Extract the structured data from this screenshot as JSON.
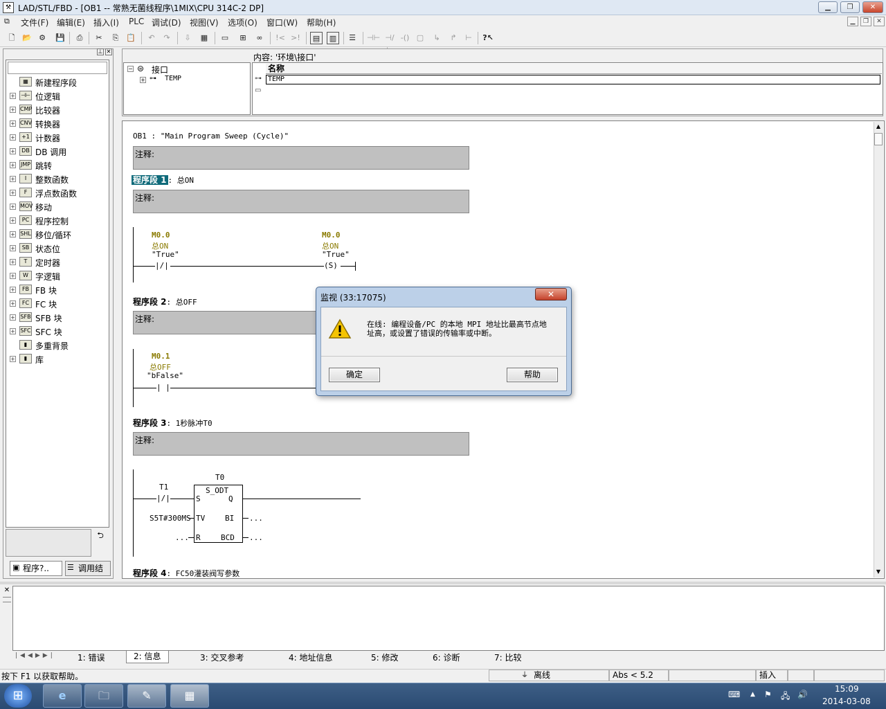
{
  "window": {
    "title": "LAD/STL/FBD  - [OB1 -- 常熟无菌线程序\\1MIX\\CPU 314C-2 DP]"
  },
  "menu": [
    "文件(F)",
    "编辑(E)",
    "插入(I)",
    "PLC",
    "调试(D)",
    "视图(V)",
    "选项(O)",
    "窗口(W)",
    "帮助(H)"
  ],
  "toolbar": {
    "icons": [
      "new-icon",
      "open-icon",
      "accessible-nodes-icon",
      "save-icon",
      "print-icon",
      "cut-icon",
      "copy-icon",
      "paste-icon",
      "undo-icon",
      "redo-icon",
      "load-icon",
      "compile-icon",
      "monitor-icon",
      "network-icon",
      "glasses-icon",
      "branch-icon",
      "overview-icon",
      "view-icon",
      "contact-no-icon",
      "contact-nc-icon",
      "coil-icon",
      "box-icon",
      "branch-open-icon",
      "branch-close-icon",
      "help-icon"
    ]
  },
  "catalog": {
    "items": [
      "新建程序段",
      "位逻辑",
      "比较器",
      "转换器",
      "计数器",
      "DB 调用",
      "跳转",
      "整数函数",
      "浮点数函数",
      "移动",
      "程序控制",
      "移位/循环",
      "状态位",
      "定时器",
      "字逻辑",
      "FB 块",
      "FC 块",
      "SFB 块",
      "SFC 块",
      "多重背景",
      "库"
    ],
    "tabs": [
      "程序?..",
      "调用结构"
    ]
  },
  "interface": {
    "content_label": "内容:  '环境\\接口'",
    "tree_root": "接口",
    "tree_child": "TEMP",
    "col_header": "名称",
    "row1": "TEMP"
  },
  "editor": {
    "ob_title": "OB1 :  \"Main Program Sweep (Cycle)\"",
    "comment_label": "注释:",
    "net1": {
      "label": "程序段 1",
      "title": ": 总ON",
      "c_addr": "M0.0",
      "c_sym": "总ON",
      "c_true": "\"True\"",
      "coil_addr": "M0.0",
      "coil_sym": "总ON",
      "coil_true": "\"True\"",
      "coil_text": "(S)"
    },
    "net2": {
      "label": "程序段 2",
      "title": ": 总OFF",
      "c_addr": "M0.1",
      "c_sym": "总OFF",
      "c_true": "\"bFalse\""
    },
    "net3": {
      "label": "程序段 3",
      "title": ": 1秒脉冲T0",
      "timer": "T0",
      "contact": "T1",
      "box": "S_ODT",
      "pin_s": "S",
      "pin_q": "Q",
      "pin_tv": "TV",
      "pin_bi": "BI",
      "pin_r": "R",
      "pin_bcd": "BCD",
      "tv_val": "S5T#300MS",
      "dots": "..."
    },
    "net4": {
      "label": "程序段 4",
      "title": ": FC50灌装阀写参数"
    }
  },
  "output_tabs": [
    "1: 错误",
    "2: 信息",
    "3: 交叉参考",
    "4: 地址信息",
    "5: 修改",
    "6: 诊断",
    "7: 比较"
  ],
  "status": {
    "help": "按下 F1 以获取帮助。",
    "mode": "离线",
    "abs": "Abs < 5.2",
    "insert": "插入"
  },
  "dialog": {
    "title": "监视 (33:17075)",
    "close": "✕",
    "message_line1": "在线: 编程设备/PC 的本地 MPI 地址比最高节点地",
    "message_line2": "址高，或设置了错误的传输率或中断。",
    "ok": "确定",
    "help": "帮助"
  },
  "taskbar": {
    "time": "15:09",
    "date": "2014-03-08"
  }
}
